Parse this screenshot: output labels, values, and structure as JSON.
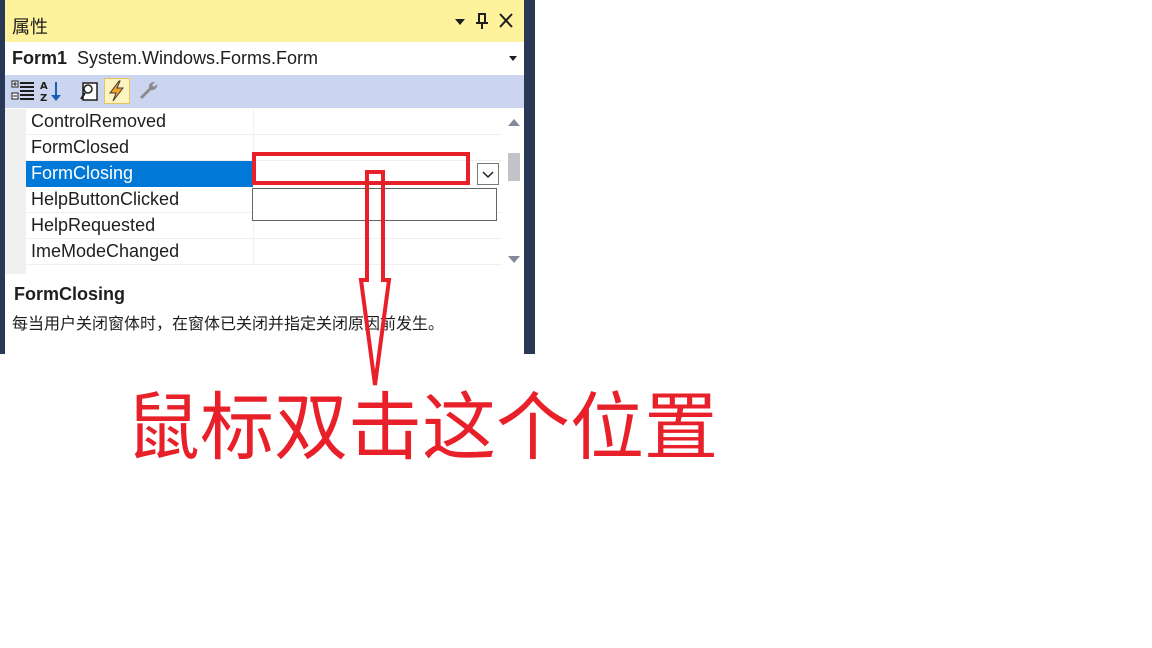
{
  "panel": {
    "title": "属性",
    "title_buttons": [
      "▾",
      "📌",
      "✕"
    ],
    "object_name": "Form1",
    "object_type": "System.Windows.Forms.Form",
    "toolbar_icons": [
      "categorized-icon",
      "alphabetical-icon",
      "properties-icon",
      "events-icon",
      "property-pages-icon"
    ]
  },
  "grid": {
    "rows": [
      {
        "name": "ControlRemoved",
        "selected": false
      },
      {
        "name": "FormClosed",
        "selected": false
      },
      {
        "name": "FormClosing",
        "selected": true
      },
      {
        "name": "HelpButtonClicked",
        "selected": false
      },
      {
        "name": "HelpRequested",
        "selected": false
      },
      {
        "name": "ImeModeChanged",
        "selected": false
      }
    ]
  },
  "description": {
    "title": "FormClosing",
    "text": "每当用户关闭窗体时，在窗体已关闭并指定关闭原因前发生。"
  },
  "annotation": {
    "text": "鼠标双击这个位置"
  },
  "colors": {
    "title_bg": "#fff29d",
    "toolbar_bg": "#ccd5f0",
    "selected_bg": "#0078d7",
    "annotation_red": "#e8202a"
  }
}
